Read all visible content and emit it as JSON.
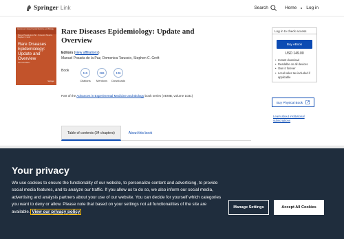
{
  "header": {
    "brand": "Springer",
    "brand_suffix": "Link",
    "search_label": "Search",
    "home_label": "Home",
    "login_label": "Log in"
  },
  "book": {
    "cover": {
      "series_line": "Advances in Experimental Medicine and Biology",
      "authors_line": "Manuel Posada de la Paz · Domenica Taruscio · Stephen C. Groft",
      "title_line1": "Rare Diseases",
      "title_line2": "Epidemiology:",
      "title_line3": "Update and",
      "title_line4": "Overview",
      "edition": "Second Edition",
      "publisher": "Springer"
    },
    "title": "Rare Diseases Epidemiology: Update and Overview",
    "editors_label": "Editors",
    "affiliations_link": "view affiliations",
    "editor_names": "Manuel Posada de la Paz, Domenica Taruscio, Stephen C. Groft",
    "type": "Book",
    "metrics": [
      {
        "value": "115",
        "label": "Citations"
      },
      {
        "value": "269",
        "label": "Mentions"
      },
      {
        "value": "106",
        "label": "Downloads"
      }
    ],
    "series_prefix": "Part of the ",
    "series_link": "Advances in Experimental Medicine and Biology",
    "series_suffix": " book series (AEMB, volume 1031)"
  },
  "panel": {
    "login_prompt": "Log in to check access",
    "buy_ebook": "Buy eBook",
    "price": "USD 149.00",
    "features": [
      "Instant download",
      "Readable on all devices",
      "Own it forever",
      "Local sales tax included if applicable"
    ],
    "buy_physical": "Buy Physical Book",
    "learn_more": "Learn about institutional subscriptions"
  },
  "tabs": [
    {
      "label": "Table of contents (34 chapters)",
      "active": true
    },
    {
      "label": "About this book",
      "active": false
    }
  ],
  "cookie": {
    "title": "Your privacy",
    "text": "We use cookies to ensure the functionality of our website, to personalize content and advertising, to provide social media features, and to analyze our traffic. If you allow us to do so, we also inform our social media, advertising and analysis partners about your use of our website. You can decide for yourself which categories you want to deny or allow. Please note that based on your settings not all functionalities of the site are available. ",
    "policy_link": "View our privacy policy",
    "manage_button": "Manage Settings",
    "accept_button": "Accept All Cookies"
  },
  "colors": {
    "accent": "#0c4bb3",
    "banner": "#1f2d3d",
    "cover": "#c2532b"
  }
}
